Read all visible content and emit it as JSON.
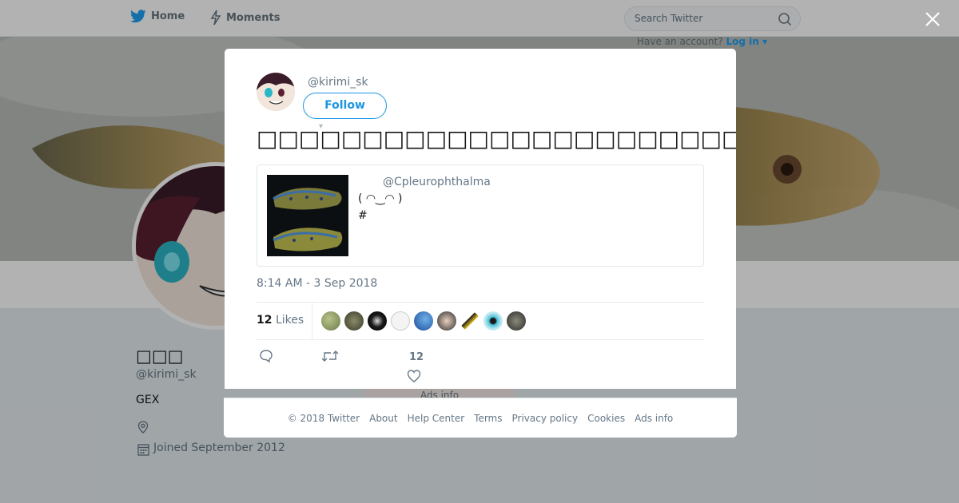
{
  "topbar": {
    "home_label": "Home",
    "moments_label": "Moments",
    "search_placeholder": "Search Twitter",
    "have_account": "Have an account?",
    "login_label": "Log in"
  },
  "profile": {
    "name": "□□□",
    "handle": "@kirimi_sk",
    "bio": "GEX",
    "joined": "Joined September 2012",
    "ads_info": "Ads info"
  },
  "tweet": {
    "handle": "@kirimi_sk",
    "follow_label": "Follow",
    "text": "□□□□□□□□□□□□□□□□□□□□□□□□□□□□□□□□□",
    "quote": {
      "handle": "@Cpleurophthalma",
      "line1": "( ◠‿◠ )",
      "line2": "#"
    },
    "timestamp": "8:14 AM - 3 Sep 2018",
    "likes_count": "12",
    "likes_label": "Likes",
    "like_action_count": "12"
  },
  "footer": {
    "copyright": "© 2018 Twitter",
    "about": "About",
    "help": "Help Center",
    "terms": "Terms",
    "privacy": "Privacy policy",
    "cookies": "Cookies",
    "ads": "Ads info"
  },
  "colors": {
    "accent": "#1b95e0",
    "twitter_blue": "#1da1f2"
  }
}
